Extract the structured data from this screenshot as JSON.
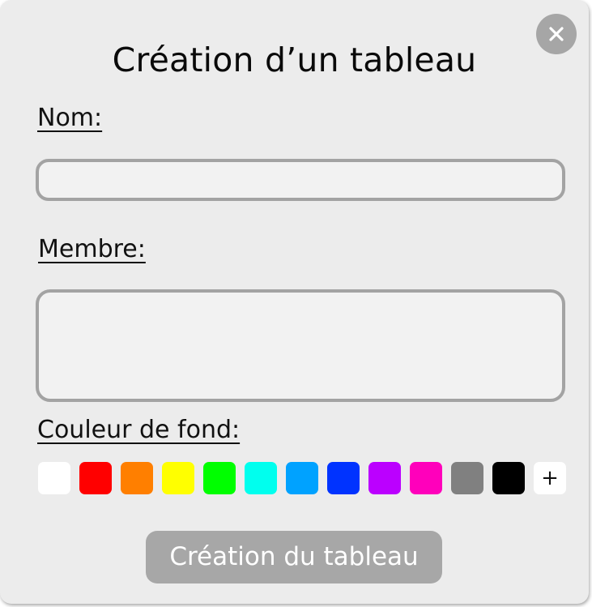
{
  "dialog": {
    "title": "Création d’un tableau",
    "close_icon": "close-icon"
  },
  "form": {
    "name_label": "Nom:",
    "name_value": "",
    "name_placeholder": "",
    "members_label": "Membre:",
    "members_value": "",
    "members_placeholder": "",
    "background_label": "Couleur de fond:",
    "swatches": [
      {
        "name": "white",
        "color": "#ffffff"
      },
      {
        "name": "red",
        "color": "#ff0000"
      },
      {
        "name": "orange",
        "color": "#ff7f00"
      },
      {
        "name": "yellow",
        "color": "#ffff00"
      },
      {
        "name": "green",
        "color": "#00ff00"
      },
      {
        "name": "cyan",
        "color": "#00ffee"
      },
      {
        "name": "light-blue",
        "color": "#00a2ff"
      },
      {
        "name": "blue",
        "color": "#0033ff"
      },
      {
        "name": "purple",
        "color": "#bb00ff"
      },
      {
        "name": "pink",
        "color": "#ff00bb"
      },
      {
        "name": "gray",
        "color": "#808080"
      },
      {
        "name": "black",
        "color": "#000000"
      }
    ],
    "add_color_label": "+",
    "submit_label": "Création du tableau"
  },
  "colors": {
    "panel_background": "#ececec",
    "input_border": "#a3a3a3",
    "button_background": "#a7a7a7"
  }
}
